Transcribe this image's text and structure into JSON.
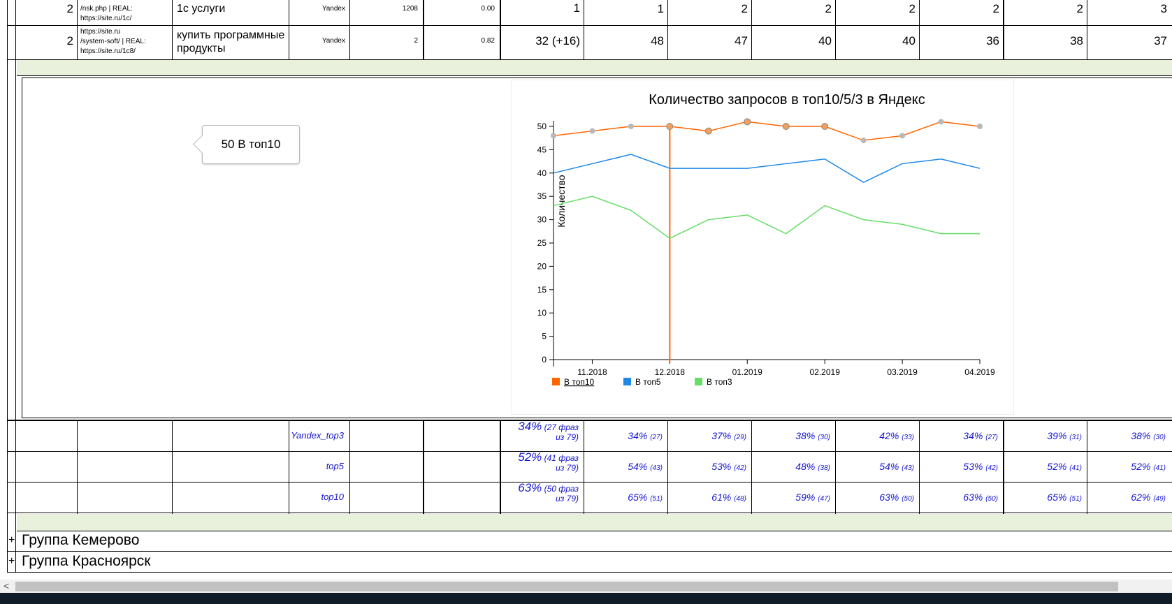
{
  "rows": [
    {
      "num": "2",
      "url_lines": [
        "/nsk.php      |      REAL:",
        "https://site.ru/1c/"
      ],
      "keyword": "1с услуги",
      "engine": "Yandex",
      "freq": "1208",
      "ratio": "0.00",
      "cur": "1",
      "hist": [
        "1",
        "2",
        "2",
        "2",
        "2",
        "2",
        "3"
      ]
    },
    {
      "num": "2",
      "url_lines": [
        "https://site.ru",
        "/system-soft/   |   REAL:",
        "https://site.ru/1c8/"
      ],
      "keyword": "купить программные продукты",
      "engine": "Yandex",
      "freq": "2",
      "ratio": "0.82",
      "cur": "32 (+16)",
      "hist": [
        "48",
        "47",
        "40",
        "40",
        "36",
        "38",
        "37"
      ]
    }
  ],
  "tooltip": "50 В топ10",
  "chart_data": {
    "type": "line",
    "title": "Количество запросов в топ10/5/3 в Яндекс",
    "ylabel": "Количество",
    "xlabel": "",
    "ylim": [
      0,
      50
    ],
    "yticks": [
      0,
      5,
      10,
      15,
      20,
      25,
      30,
      35,
      40,
      45,
      50
    ],
    "x_tick_labels": [
      "11.2018",
      "12.2018",
      "01.2019",
      "02.2019",
      "03.2019",
      "04.2019"
    ],
    "series": [
      {
        "name": "В топ10",
        "color": "#ff6600",
        "values": [
          48,
          49,
          50,
          50,
          49,
          51,
          50,
          50,
          47,
          48,
          51,
          50
        ]
      },
      {
        "name": "В топ5",
        "color": "#1e88e5",
        "values": [
          40,
          42,
          44,
          41,
          41,
          41,
          42,
          43,
          38,
          42,
          43,
          41
        ]
      },
      {
        "name": "В топ3",
        "color": "#66dd66",
        "values": [
          33,
          35,
          32,
          26,
          30,
          31,
          27,
          33,
          30,
          29,
          27,
          27
        ]
      }
    ],
    "highlight_index": 3,
    "legend_position": "bottom-left"
  },
  "stats": [
    {
      "label": "Yandex_top3",
      "main_pct": "34%",
      "main_note": "(27 фраз",
      "main_note2": "из 79)",
      "cells": [
        [
          "34%",
          "(27)"
        ],
        [
          "37%",
          "(29)"
        ],
        [
          "38%",
          "(30)"
        ],
        [
          "42%",
          "(33)"
        ],
        [
          "34%",
          "(27)"
        ],
        [
          "39%",
          "(31)"
        ],
        [
          "38%",
          "(30)"
        ]
      ]
    },
    {
      "label": "top5",
      "main_pct": "52%",
      "main_note": "(41 фраз",
      "main_note2": "из 79)",
      "cells": [
        [
          "54%",
          "(43)"
        ],
        [
          "53%",
          "(42)"
        ],
        [
          "48%",
          "(38)"
        ],
        [
          "54%",
          "(43)"
        ],
        [
          "53%",
          "(42)"
        ],
        [
          "52%",
          "(41)"
        ],
        [
          "52%",
          "(41)"
        ]
      ]
    },
    {
      "label": "top10",
      "main_pct": "63%",
      "main_note": "(50 фраз",
      "main_note2": "из 79)",
      "cells": [
        [
          "65%",
          "(51)"
        ],
        [
          "61%",
          "(48)"
        ],
        [
          "59%",
          "(47)"
        ],
        [
          "63%",
          "(50)"
        ],
        [
          "63%",
          "(50)"
        ],
        [
          "65%",
          "(51)"
        ],
        [
          "62%",
          "(49)"
        ]
      ]
    }
  ],
  "groups": [
    {
      "expander": "+",
      "name": "Группа Кемерово"
    },
    {
      "expander": "+",
      "name": "Группа Красноярск"
    }
  ],
  "scrollbar": {
    "left_arrow": "<"
  }
}
